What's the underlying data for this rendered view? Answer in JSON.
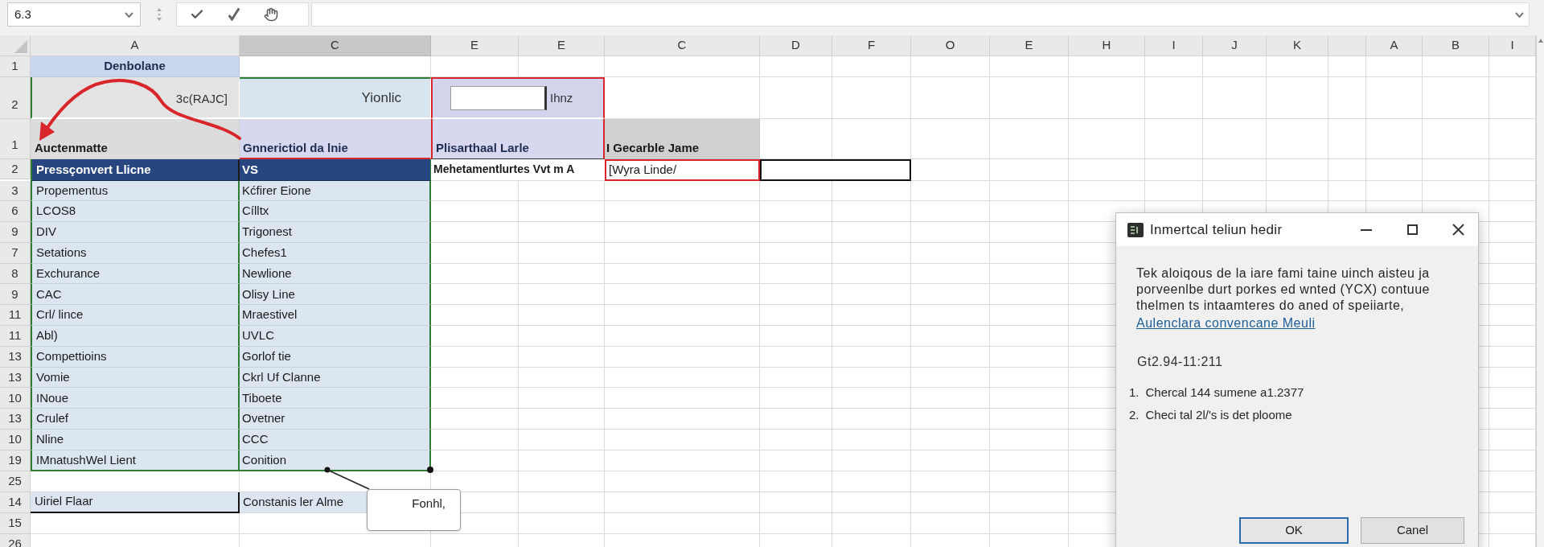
{
  "formula_bar": {
    "name_box": "6.3"
  },
  "column_headers": [
    {
      "label": "A",
      "selected": false
    },
    {
      "label": "C",
      "selected": true
    },
    {
      "label": "E",
      "selected": false
    },
    {
      "label": "E",
      "selected": false
    },
    {
      "label": "C",
      "selected": false
    },
    {
      "label": "D",
      "selected": false
    },
    {
      "label": "F",
      "selected": false
    },
    {
      "label": "O",
      "selected": false
    },
    {
      "label": "E",
      "selected": false
    },
    {
      "label": "H",
      "selected": false
    },
    {
      "label": "I",
      "selected": false
    },
    {
      "label": "J",
      "selected": false
    },
    {
      "label": "K",
      "selected": false
    },
    {
      "selected": false
    },
    {
      "label": "A",
      "selected": false
    },
    {
      "label": "B",
      "selected": false
    },
    {
      "label": "I",
      "selected": false
    }
  ],
  "rows": [
    {
      "kind": "title",
      "number": "1",
      "cells": [
        "Denbolane"
      ]
    },
    {
      "kind": "input",
      "number": "2",
      "cells": [
        "3c(RAJC]",
        "Yionlic",
        "Ihnz"
      ]
    },
    {
      "kind": "header",
      "number": "1",
      "cells": [
        "Auctenmatte",
        "Gnnerictiol da lnie",
        "Plisarthaal Larle",
        "I Gecarble Jame"
      ]
    },
    {
      "kind": "active",
      "number": "2",
      "selected": true,
      "cells": [
        "Pressçonvert Llicne",
        "VS",
        "Mehetamentlurtes Vvt m A",
        "[Wyra Linde/"
      ]
    },
    {
      "kind": "data",
      "number": "3",
      "selected": false,
      "cells": [
        "Propementus",
        "Kćfirer Eione"
      ]
    },
    {
      "kind": "data",
      "number": "6",
      "selected": false,
      "cells": [
        "LCOS8",
        "Cílltx"
      ]
    },
    {
      "kind": "data",
      "number": "9",
      "selected": false,
      "cells": [
        "DIV",
        "Trigonest"
      ]
    },
    {
      "kind": "data",
      "number": "7",
      "selected": false,
      "cells": [
        "Setations",
        "Chefes1"
      ]
    },
    {
      "kind": "data",
      "number": "8",
      "selected": false,
      "cells": [
        "Exchurance",
        "Newlione"
      ]
    },
    {
      "kind": "data",
      "number": "9",
      "selected": false,
      "cells": [
        "CAC",
        "Olisy Line"
      ]
    },
    {
      "kind": "data",
      "number": "11",
      "selected": false,
      "cells": [
        "Crl/ lince",
        "Mraestivel"
      ]
    },
    {
      "kind": "data",
      "number": "11",
      "selected": false,
      "cells": [
        "Abl)",
        "UVLC"
      ]
    },
    {
      "kind": "data",
      "number": "13",
      "selected": false,
      "cells": [
        "Compettioins",
        "Gorlof tie"
      ]
    },
    {
      "kind": "data",
      "number": "13",
      "selected": false,
      "cells": [
        "Vomie",
        "Ckrl Uf Clanne"
      ]
    },
    {
      "kind": "data",
      "number": "10",
      "selected": false,
      "cells": [
        "INoue",
        "Tiboete"
      ]
    },
    {
      "kind": "data",
      "number": "13",
      "selected": false,
      "cells": [
        "Crulef",
        "Ovetner"
      ]
    },
    {
      "kind": "data",
      "number": "10",
      "selected": false,
      "cells": [
        "Nline",
        "CCC"
      ]
    },
    {
      "kind": "data",
      "number": "19",
      "selected": false,
      "cells": [
        "IMnatushWel Lient",
        "Conition"
      ]
    },
    {
      "kind": "blank",
      "number": "25"
    },
    {
      "kind": "footer",
      "number": "14",
      "selected": false,
      "cells": [
        "Uiriel Flaar",
        "Constanis ler Alme"
      ]
    },
    {
      "kind": "blank",
      "number": "15"
    },
    {
      "kind": "blank",
      "number": "26"
    }
  ],
  "callout": {
    "text": "Fonhl,"
  },
  "dialog": {
    "title": "Inmertcal teliun hedir",
    "message": "Tek aloiqous de la iare fami taine uinch aisteu ja porveenlbe durt porkes ed wnted (YCX) contuue thelmen ts intaamteres do aned of speiiarte,",
    "link": "Aulenclara convencane Meuli",
    "code": "Gt2.94-11:211",
    "steps": [
      {
        "number": "1.",
        "text": "Chercal 144 sumene a1.2377"
      },
      {
        "number": "2.",
        "text": "Checi tal 2l/'s is det ploome"
      }
    ],
    "buttons": [
      {
        "label": "OK",
        "default": true
      },
      {
        "label": "Canel",
        "default": false
      }
    ]
  }
}
